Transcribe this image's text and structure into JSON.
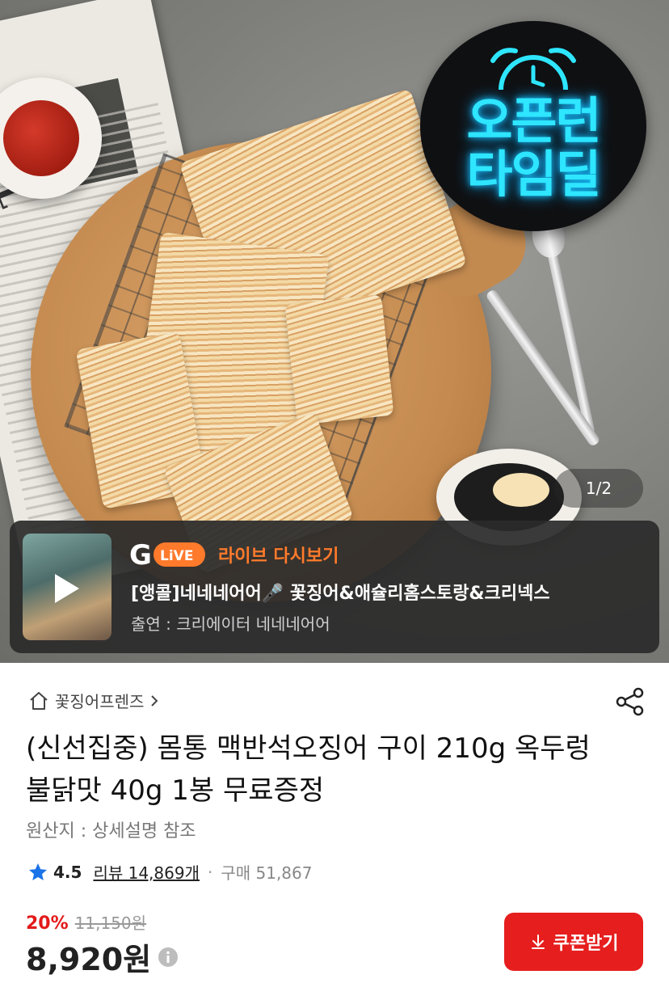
{
  "hero": {
    "promo_badge_line1": "오픈런",
    "promo_badge_line2": "타임딜",
    "page_indicator": "1/2",
    "newspaper_text": "TOP SEL"
  },
  "live_banner": {
    "title": "라이브 다시보기",
    "product_desc": "[앵콜]네네네어어🎤 꽃징어&애슐리홈스토랑&크리넥스",
    "cast": "출연 : 크리에이터 네네네어어",
    "logo_text": "LiVE"
  },
  "store": {
    "name": "꽃징어프렌즈"
  },
  "product": {
    "title": "(신선집중) 몸통 맥반석오징어 구이 210g 옥두렁 불닭맛 40g 1봉 무료증정",
    "origin": "원산지 : 상세설명 참조",
    "rating": "4.5",
    "review_label": "리뷰 14,869개",
    "purchase_label": "구매 51,867",
    "discount_rate": "20%",
    "original_price": "11,150원",
    "sale_price": "8,920원"
  },
  "actions": {
    "coupon_label": "쿠폰받기"
  },
  "colors": {
    "accent_red": "#e61e1e",
    "live_orange": "#ff7a2b",
    "star_blue": "#1a73e8",
    "neon_cyan": "#2ee6ff"
  }
}
